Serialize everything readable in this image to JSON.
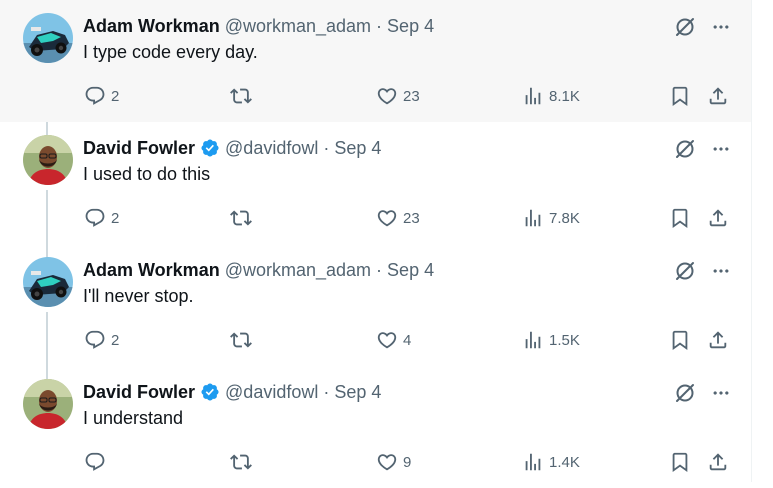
{
  "colors": {
    "verified": "#1d9bf0",
    "text_primary": "#0f1419",
    "text_secondary": "#536471",
    "thread_line": "#cfd9de",
    "highlight_bg": "#f7f7f7"
  },
  "tweets": [
    {
      "author": "Adam Workman",
      "handle": "@workman_adam",
      "separator": "·",
      "date": "Sep 4",
      "verified": false,
      "avatar_icon": "race-car-avatar",
      "text": "I type code every day.",
      "replies": "2",
      "retweets": "",
      "likes": "23",
      "views": "8.1K"
    },
    {
      "author": "David Fowler",
      "handle": "@davidfowl",
      "separator": "·",
      "date": "Sep 4",
      "verified": true,
      "avatar_icon": "person-photo-avatar",
      "text": "I used to do this",
      "replies": "2",
      "retweets": "",
      "likes": "23",
      "views": "7.8K"
    },
    {
      "author": "Adam Workman",
      "handle": "@workman_adam",
      "separator": "·",
      "date": "Sep 4",
      "verified": false,
      "avatar_icon": "race-car-avatar",
      "text": "I'll never stop.",
      "replies": "2",
      "retweets": "",
      "likes": "4",
      "views": "1.5K"
    },
    {
      "author": "David Fowler",
      "handle": "@davidfowl",
      "separator": "·",
      "date": "Sep 4",
      "verified": true,
      "avatar_icon": "person-photo-avatar",
      "text": "I understand",
      "replies": "",
      "retweets": "",
      "likes": "9",
      "views": "1.4K"
    }
  ]
}
